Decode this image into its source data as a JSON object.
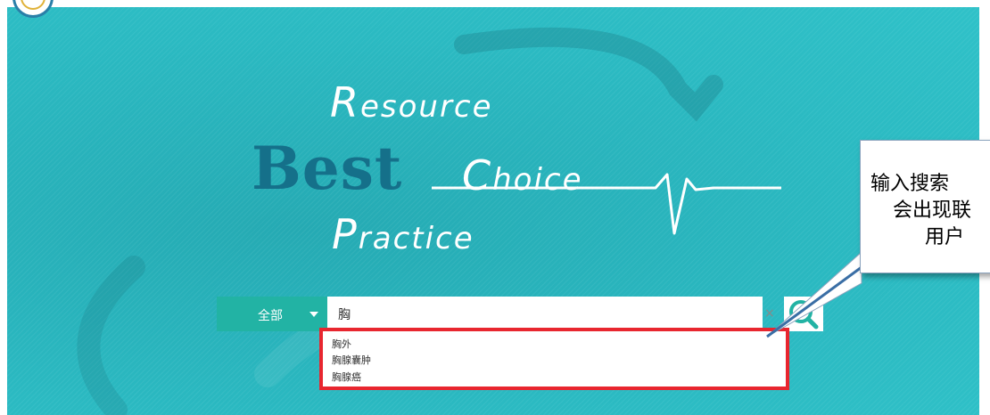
{
  "hero": {
    "title_resource_cap": "R",
    "title_resource_rest": "esource",
    "title_best": "Best",
    "title_choice_cap": "C",
    "title_choice_rest": "hoice",
    "title_practice_cap": "P",
    "title_practice_rest": "ractice"
  },
  "search": {
    "scope_label": "全部",
    "query": "胸",
    "clear_glyph": "×"
  },
  "suggestions": [
    "胸外",
    "胸腺囊肿",
    "胸腺癌"
  ],
  "callout": {
    "lines": [
      "输入搜索",
      "会出现联",
      "用户"
    ]
  },
  "colors": {
    "hero_bg": "#2ab8c0",
    "best_text": "#15708a",
    "scope_bg": "#22b3a4",
    "highlight_border": "#e8262f"
  }
}
